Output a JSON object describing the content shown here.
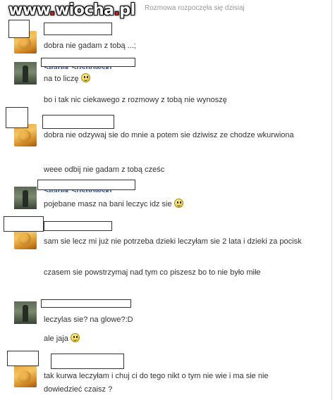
{
  "watermark": {
    "pre": "www",
    "dot1": ".",
    "mid": "wiocha",
    "dot2": ".",
    "post": "pl"
  },
  "conversation_started": "Rozmowa rozpoczęła się dzisiaj",
  "name_b": "Sęarek Susnowski",
  "messages": [
    {
      "text": "dobra nie gadam z tobą ...;"
    },
    {
      "text": "na to liczę"
    },
    {
      "text": "bo i tak nic ciekawego z rozmowy z tobą nie wynoszę"
    },
    {
      "text": "dobra nie odzywaj sie do mnie a potem sie dziwisz ze chodze wkurwiona"
    },
    {
      "text": "weee odbij nie gadam z tobą cześc"
    },
    {
      "text": "pojebane masz na bani leczyc idz sie"
    },
    {
      "text": "sam sie lecz mi już nie potrzeba dzieki leczyłam sie 2 lata i dzieki za pocisk"
    },
    {
      "text": "czasem sie powstrzymaj nad tym co piszesz bo to nie było miłe"
    },
    {
      "text": "leczylas sie? na glowe?:D"
    },
    {
      "text": "ale jaja"
    },
    {
      "text": "tak kurwa leczyłam i chuj ci do tego nikt o tym nie wie i ma sie nie dowiedzieć czaisz ?"
    }
  ],
  "icons": {
    "smiley": "smiley-emoticon-icon"
  }
}
